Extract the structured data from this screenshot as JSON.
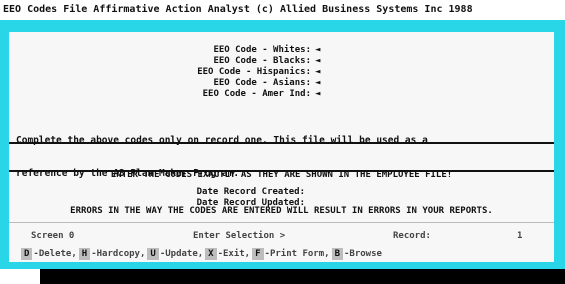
{
  "window": {
    "title": "EEO Codes File Affirmative Action Analyst (c) Allied Business Systems Inc 1988"
  },
  "codes": [
    {
      "label": "EEO Code - Whites:",
      "marker": "◄"
    },
    {
      "label": "EEO Code - Blacks:",
      "marker": "◄"
    },
    {
      "label": "EEO Code - Hispanics:",
      "marker": "◄"
    },
    {
      "label": "EEO Code - Asians:",
      "marker": "◄"
    },
    {
      "label": "EEO Code - Amer Ind:",
      "marker": "◄"
    }
  ],
  "note": {
    "line1": "Complete the above codes only on record one. This file will be used as a",
    "line2": "reference by the A3 Plan Maker Program."
  },
  "warning": {
    "line1": "ENTER THE CODES EXACTLY AS THEY ARE SHOWN IN THE EMPLOYEE FILE!",
    "line2": "ERRORS IN THE WAY THE CODES ARE ENTERED WILL RESULT IN ERRORS IN YOUR REPORTS."
  },
  "dates": {
    "created_label": "Date Record Created:",
    "updated_label": "Date Record Updated:",
    "created_value": "",
    "updated_value": ""
  },
  "status": {
    "screen_label": "Screen 0",
    "prompt": "Enter Selection >",
    "record_label": "Record:",
    "record_value": "1"
  },
  "function_keys": [
    {
      "key": "D",
      "label": "-Delete,"
    },
    {
      "key": "H",
      "label": "-Hardcopy,"
    },
    {
      "key": "U",
      "label": "-Update,"
    },
    {
      "key": "X",
      "label": "-Exit,"
    },
    {
      "key": "F",
      "label": "-Print Form,"
    },
    {
      "key": "B",
      "label": "-Browse"
    }
  ],
  "colors": {
    "frame": "#29d6e8",
    "panel": "#f7f7f7",
    "key_background": "#bdbdbd"
  }
}
